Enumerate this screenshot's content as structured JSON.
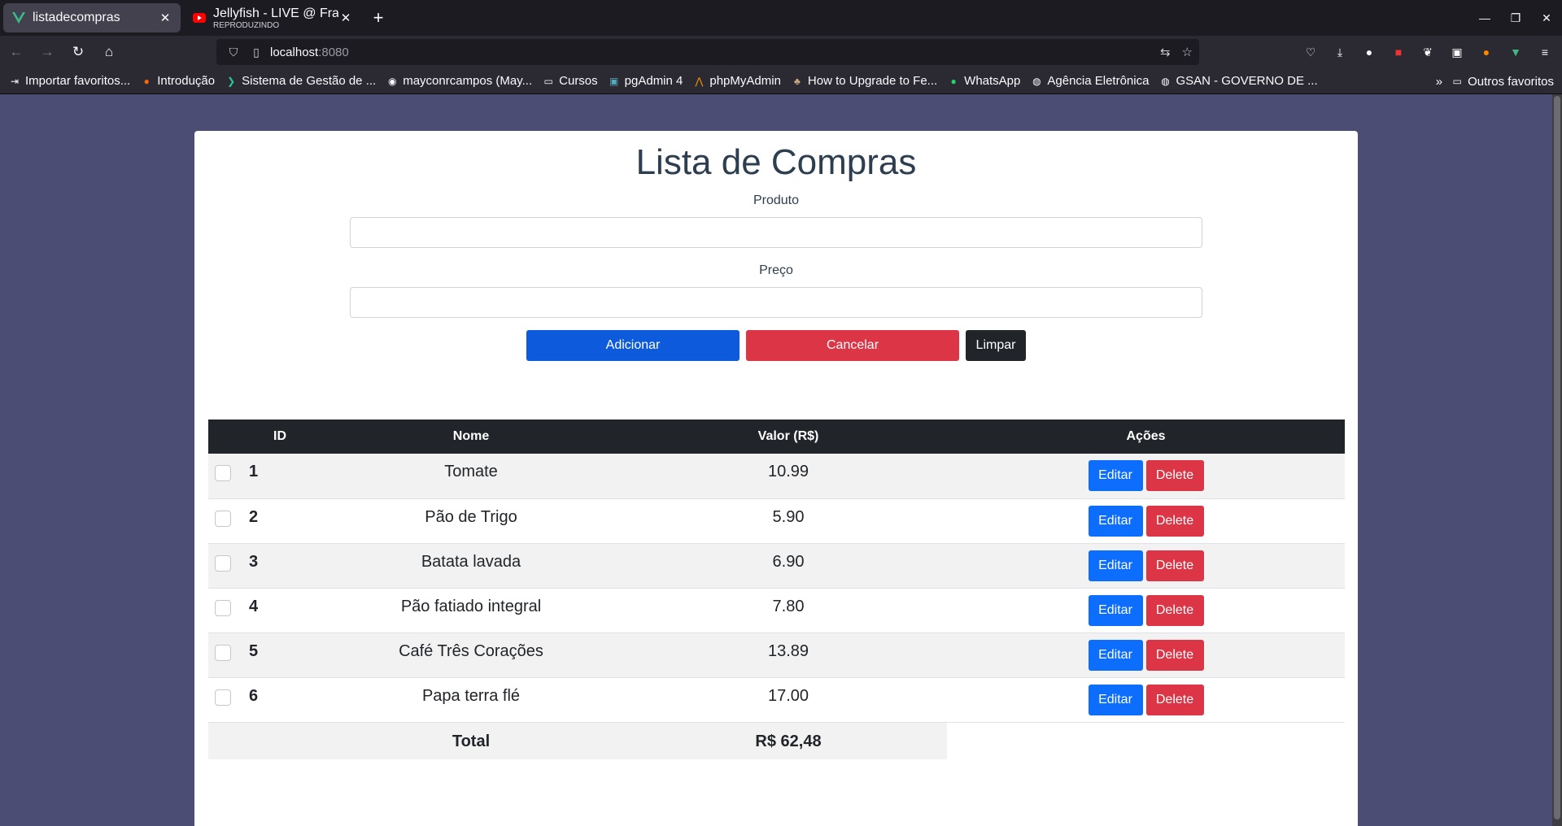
{
  "browser": {
    "tabs": [
      {
        "title": "listadecompras",
        "active": true
      },
      {
        "title": "Jellyfish - LIVE @ Frankfurt",
        "subtitle": "REPRODUZINDO",
        "active": false
      }
    ],
    "url_host": "localhost",
    "url_port": ":8080",
    "bookmarks": [
      "Importar favoritos...",
      "Introdução",
      "Sistema de Gestão de ...",
      "mayconrcampos (May...",
      "Cursos",
      "pgAdmin 4",
      "phpMyAdmin",
      "How to Upgrade to Fe...",
      "WhatsApp",
      "Agência Eletrônica",
      "GSAN - GOVERNO DE ..."
    ],
    "other_bookmarks": "Outros favoritos"
  },
  "app": {
    "title": "Lista de Compras",
    "produto_label": "Produto",
    "produto_value": "",
    "preco_label": "Preço",
    "preco_value": "",
    "btn_add": "Adicionar",
    "btn_cancel": "Cancelar",
    "btn_clear": "Limpar"
  },
  "table": {
    "headers": {
      "id": "ID",
      "nome": "Nome",
      "valor": "Valor (R$)",
      "acoes": "Ações"
    },
    "rows": [
      {
        "id": "1",
        "nome": "Tomate",
        "valor": "10.99",
        "checked": false
      },
      {
        "id": "2",
        "nome": "Pão de Trigo",
        "valor": "5.90",
        "checked": false
      },
      {
        "id": "3",
        "nome": "Batata lavada",
        "valor": "6.90",
        "checked": false
      },
      {
        "id": "4",
        "nome": "Pão fatiado integral",
        "valor": "7.80",
        "checked": false
      },
      {
        "id": "5",
        "nome": "Café Três Corações",
        "valor": "13.89",
        "checked": false
      },
      {
        "id": "6",
        "nome": "Papa terra flé",
        "valor": "17.00",
        "checked": false
      }
    ],
    "edit_label": "Editar",
    "delete_label": "Delete",
    "total_label": "Total",
    "total_value": "R$ 62,48"
  }
}
